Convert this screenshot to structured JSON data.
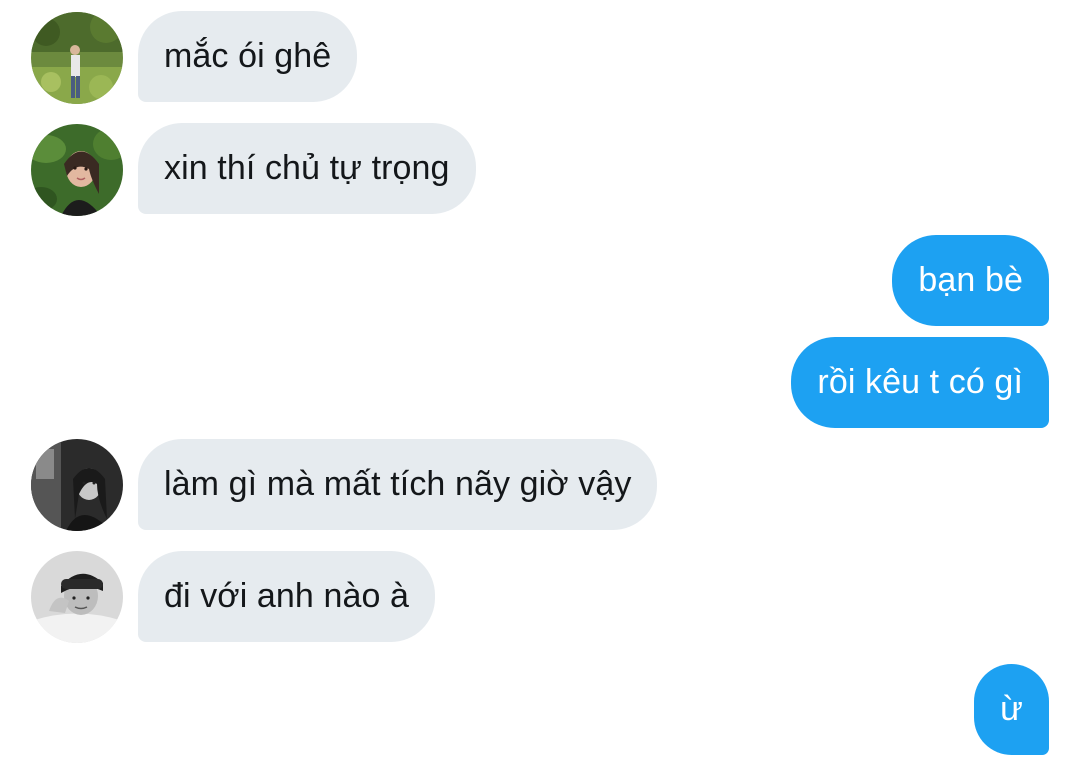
{
  "messages": [
    {
      "direction": "in",
      "avatar": "avatar-outdoor-garden",
      "text": "mắc ói ghê"
    },
    {
      "direction": "in",
      "avatar": "avatar-woman-leaves",
      "text": "xin thí chủ tự trọng"
    },
    {
      "direction": "out",
      "text": "bạn bè"
    },
    {
      "direction": "out",
      "text": "rồi kêu t có gì"
    },
    {
      "direction": "in",
      "avatar": "avatar-woman-monochrome",
      "text": "làm gì mà mất tích nãy giờ vậy"
    },
    {
      "direction": "in",
      "avatar": "avatar-man-monochrome",
      "text": "đi với anh nào à"
    },
    {
      "direction": "out",
      "text": "ừ"
    }
  ],
  "colors": {
    "incoming_bubble": "#e6ebef",
    "outgoing_bubble": "#1da1f2",
    "incoming_text": "#14171a",
    "outgoing_text": "#ffffff",
    "background": "#ffffff"
  }
}
